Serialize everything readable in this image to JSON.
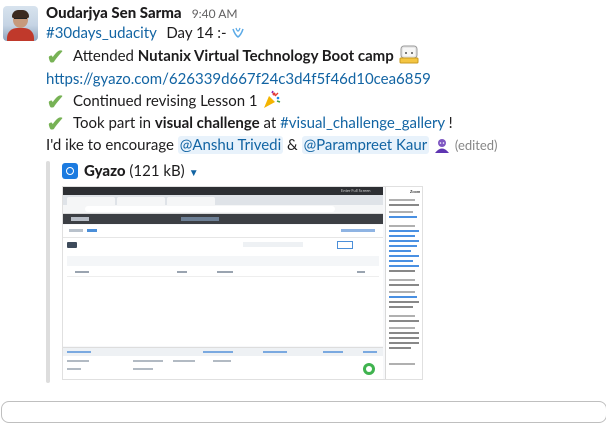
{
  "message": {
    "author": "Oudarjya Sen Sarma",
    "time": "9:40 AM",
    "hashtag": "#30days_udacity",
    "day_text": "Day 14 :-",
    "line1_pre": "Attended ",
    "line1_bold": "Nutanix Virtual Technology Boot camp",
    "link": "https://gyazo.com/626339d667f24c3d4f5f46d10cea6859",
    "line3": "Continued revising Lesson 1",
    "line4_pre": "Took part in ",
    "line4_bold": "visual challenge",
    "line4_mid": " at ",
    "line4_channel": "#visual_challenge_gallery",
    "line4_end": " !",
    "line5_pre": "I'd ike to encourage ",
    "mention1": "@Anshu Trivedi",
    "amp": " & ",
    "mention2": "@Parampreet Kaur",
    "edited": "(edited)"
  },
  "attachment": {
    "service": "Gyazo",
    "size": "(121 kB)",
    "preview_title": "Zoom",
    "preview_button": "Enter Full Screen"
  },
  "icons": {
    "check": "white-check-mark-emoji",
    "party": "party-popper-emoji",
    "dance": "dancer-emoji"
  },
  "colors": {
    "link": "#1264a3",
    "check": "#77b255",
    "mention_bg": "#e8f2fb"
  }
}
